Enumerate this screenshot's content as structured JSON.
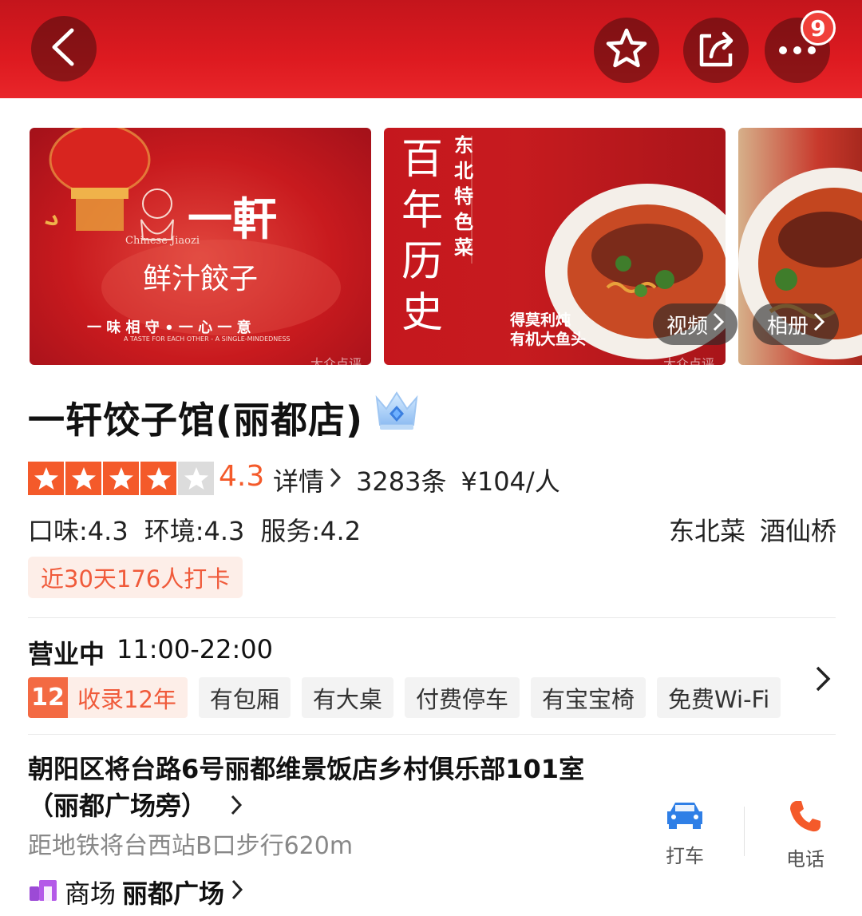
{
  "header": {
    "back_icon": "chevron-left-icon",
    "favorite_icon": "star-outline-icon",
    "share_icon": "share-icon",
    "more_icon": "more-dots-icon",
    "more_badge": "9",
    "bar_color": "#d81a20"
  },
  "gallery": {
    "photo1": {
      "brand": "一軒",
      "brand_en": "Chinese Jiaozi",
      "slogan": "鲜汁餃子",
      "line": "一 味 相 守 • 一 心 一 意",
      "line_en": "A TASTE FOR EACH OTHER - A SINGLE-MINDEDNESS",
      "watermark": "大众点评"
    },
    "photo2": {
      "vertical_title": "百年历史",
      "vertical_sub": "东北特色菜",
      "dish_line1": "得莫利炖",
      "dish_line2": "有机大鱼头",
      "watermark": "大众点评"
    },
    "video_label": "视频",
    "album_label": "相册"
  },
  "shop": {
    "name": "一轩饺子馆(丽都店)",
    "crown_icon": "diamond-crown-icon",
    "stars_filled": 4,
    "stars_total": 5,
    "score": "4.3",
    "details_label": "详情",
    "review_count": "3283条",
    "price": "¥104/人",
    "taste": "口味:4.3",
    "environment": "环境:4.3",
    "service": "服务:4.2",
    "cuisine": "东北菜",
    "area": "酒仙桥",
    "checkin": "近30天176人打卡",
    "status": "营业中",
    "hours": "11:00-22:00",
    "years_num": "12",
    "years_label": "收录12年",
    "tags": [
      "有包厢",
      "有大桌",
      "付费停车",
      "有宝宝椅",
      "免费Wi-Fi"
    ],
    "address": "朝阳区将台路6号丽都维景饭店乡村俱乐部101室（丽都广场旁）",
    "metro": "距地铁将台西站B口步行620m",
    "mall_prefix": "商场",
    "mall_name": "丽都广场",
    "accent_color": "#f45a2a"
  },
  "actions": {
    "taxi_label": "打车",
    "taxi_icon": "car-icon",
    "phone_label": "电话",
    "phone_icon": "phone-icon"
  }
}
